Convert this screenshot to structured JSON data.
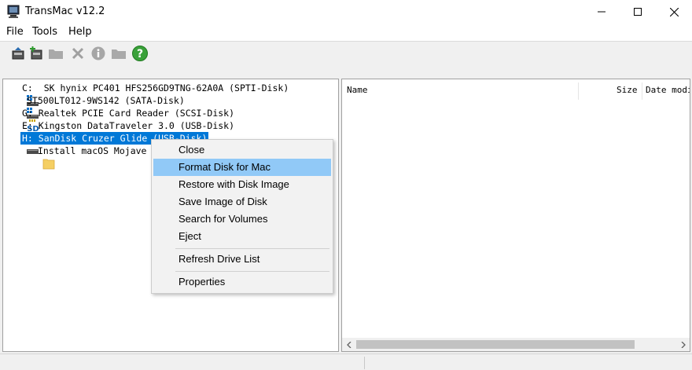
{
  "window": {
    "title": "TransMac v12.2",
    "controls": {
      "minimize": "—",
      "maximize": "☐",
      "close": "✕"
    }
  },
  "menubar": {
    "items": [
      "File",
      "Tools",
      "Help"
    ]
  },
  "toolbar": {
    "icons": [
      "open-disk-image-icon",
      "add-icon",
      "folder-icon",
      "delete-icon",
      "info-icon",
      "new-folder-icon",
      "help-icon"
    ]
  },
  "tree": {
    "items": [
      {
        "label": "C:  SK hynix PC401 HFS256GD9TNG-62A0A (SPTI-Disk)",
        "icon": "drive-icon"
      },
      {
        "label": "ST500LT012-9WS142 (SATA-Disk)",
        "icon": "drive-icon"
      },
      {
        "label": "G: Realtek PCIE Card Reader (SCSI-Disk)",
        "icon": "sd-card-icon"
      },
      {
        "label": "E: Kingston DataTraveler 3.0 (USB-Disk)",
        "icon": "usb-drive-icon"
      },
      {
        "label": "H: SanDisk Cruzer Glide (USB-Disk)",
        "icon": "usb-drive-icon",
        "selected": true
      },
      {
        "label": "Install macOS Mojave",
        "icon": "folder-icon"
      }
    ]
  },
  "file_list": {
    "columns": [
      "Name",
      "Size",
      "Date modi"
    ]
  },
  "context_menu": {
    "items": [
      "Close",
      "Format Disk for Mac",
      "Restore with Disk Image",
      "Save Image of Disk",
      "Search for Volumes",
      "Eject",
      "Refresh Drive List",
      "Properties"
    ],
    "highlighted": "Format Disk for Mac"
  },
  "colors": {
    "selection": "#0078d7",
    "menu_hover": "#91c9f7",
    "help_green": "#3aa13a"
  }
}
